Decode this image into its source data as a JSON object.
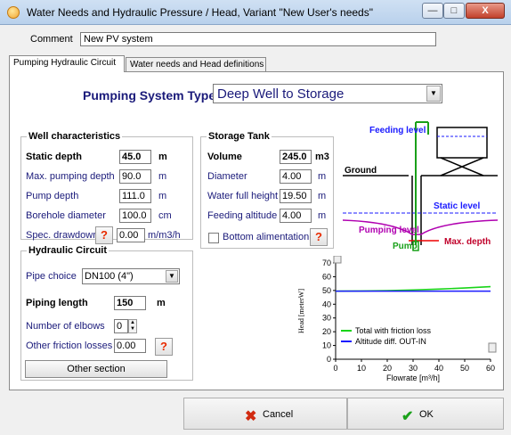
{
  "window": {
    "title": "Water Needs and Hydraulic Pressure / Head, Variant  \"New User's needs\"",
    "min_glyph": "—",
    "max_glyph": "□",
    "close_glyph": "X"
  },
  "comment": {
    "label": "Comment",
    "value": "New PV system"
  },
  "tabs": [
    {
      "label": "Pumping Hydraulic Circuit"
    },
    {
      "label": "Water needs and Head definitions"
    }
  ],
  "pumping_system": {
    "label": "Pumping System Type",
    "selected": "Deep Well to Storage"
  },
  "well": {
    "title": "Well characteristics",
    "static_depth": {
      "label": "Static depth",
      "value": "45.0",
      "unit": "m"
    },
    "max_pumping_depth": {
      "label": "Max. pumping depth",
      "value": "90.0",
      "unit": "m"
    },
    "pump_depth": {
      "label": "Pump depth",
      "value": "111.0",
      "unit": "m"
    },
    "borehole_diameter": {
      "label": "Borehole diameter",
      "value": "100.0",
      "unit": "cm"
    },
    "spec_drawdown": {
      "label": "Spec. drawdown",
      "value": "0.00",
      "unit": "m/m3/h"
    }
  },
  "tank": {
    "title": "Storage Tank",
    "volume": {
      "label": "Volume",
      "value": "245.0",
      "unit": "m3"
    },
    "diameter": {
      "label": "Diameter",
      "value": "4.00",
      "unit": "m"
    },
    "water_full_height": {
      "label": "Water full height",
      "value": "19.50",
      "unit": "m"
    },
    "feeding_altitude": {
      "label": "Feeding altitude",
      "value": "4.00",
      "unit": "m"
    },
    "bottom_alimentation": {
      "label": "Bottom alimentation",
      "checked": false
    }
  },
  "hydraulic": {
    "title": "Hydraulic Circuit",
    "pipe_choice": {
      "label": "Pipe choice",
      "value": "DN100 (4\")"
    },
    "piping_length": {
      "label": "Piping length",
      "value": "150",
      "unit": "m"
    },
    "elbows": {
      "label": "Number of elbows",
      "value": "0"
    },
    "other_friction": {
      "label": "Other friction losses",
      "value": "0.00"
    },
    "other_section_label": "Other section"
  },
  "help_glyph": "?",
  "diagram": {
    "feeding_level": "Feeding level",
    "ground": "Ground",
    "static_level": "Static level",
    "pumping_level": "Pumping level",
    "pump": "Pump",
    "max_depth": "Max. depth"
  },
  "chart_data": {
    "type": "line",
    "xlabel": "Flowrate [m³/h]",
    "ylabel": "Head [meterW]",
    "xlim": [
      0,
      60
    ],
    "ylim": [
      0,
      70
    ],
    "xticks": [
      0,
      10,
      20,
      30,
      40,
      50,
      60
    ],
    "yticks": [
      0,
      10,
      20,
      30,
      40,
      50,
      60,
      70
    ],
    "grid": false,
    "legend_position": "bottom-left",
    "series": [
      {
        "name": "Total with friction loss",
        "color": "#19d419",
        "x": [
          0,
          10,
          20,
          30,
          40,
          50,
          60
        ],
        "y": [
          49.5,
          49.6,
          49.9,
          50.4,
          51.0,
          51.8,
          52.8
        ]
      },
      {
        "name": "Altitude diff. OUT-IN",
        "color": "#1a1aff",
        "x": [
          0,
          60
        ],
        "y": [
          49.5,
          49.5
        ]
      }
    ]
  },
  "buttons": {
    "cancel": {
      "label": "Cancel",
      "icon": "✖"
    },
    "ok": {
      "label": "OK",
      "icon": "✔"
    }
  },
  "colors": {
    "accent_text": "#1a1a7a",
    "help": "#e82a00",
    "diagram_blue": "#1a1aff",
    "diagram_green": "#19a019",
    "diagram_magenta": "#b000b0"
  }
}
